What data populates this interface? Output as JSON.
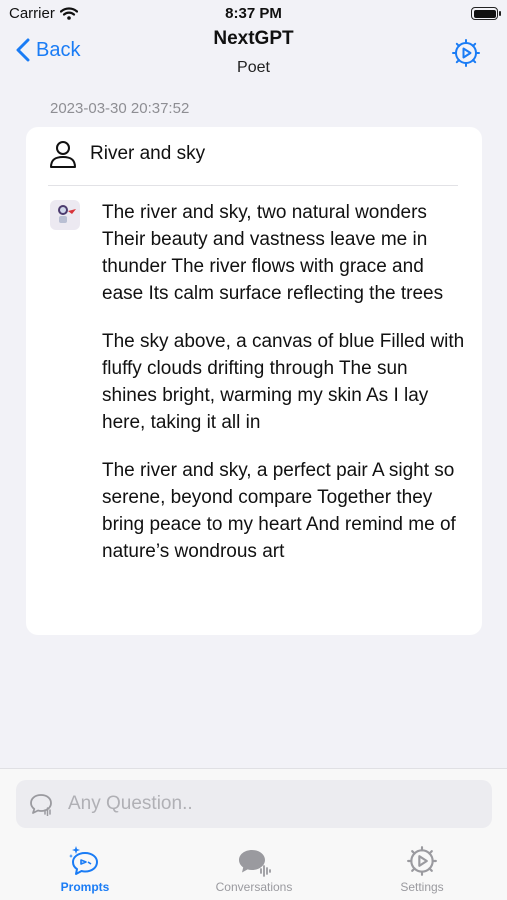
{
  "status_bar": {
    "carrier": "Carrier",
    "time": "8:37 PM",
    "battery_level": 1.0
  },
  "nav": {
    "back_label": "Back",
    "title": "NextGPT",
    "subtitle": "Poet",
    "settings_icon": "gear-play-icon"
  },
  "chat": {
    "timestamp": "2023-03-30 20:37:52",
    "prompt": "River and sky",
    "response_paragraphs": [
      "The river and sky, two natural wonders Their beauty and vastness leave me in thunder The river flows with grace and ease Its calm surface reflecting the trees",
      "The sky above, a canvas of blue Filled with fluffy clouds drifting through The sun shines bright, warming my skin As I lay here, taking it all in",
      "The river and sky, a perfect pair A sight so serene, beyond compare Together they bring peace to my heart And remind me of nature’s wondrous art"
    ]
  },
  "input": {
    "placeholder": "Any Question.."
  },
  "tabs": [
    {
      "label": "Prompts",
      "icon": "prompts-icon",
      "active": true
    },
    {
      "label": "Conversations",
      "icon": "conversations-icon",
      "active": false
    },
    {
      "label": "Settings",
      "icon": "gear-play-icon",
      "active": false
    }
  ],
  "colors": {
    "accent": "#1a7cf5",
    "background": "#f2f2f7",
    "card": "#ffffff",
    "inactive": "#9a9a9f"
  }
}
